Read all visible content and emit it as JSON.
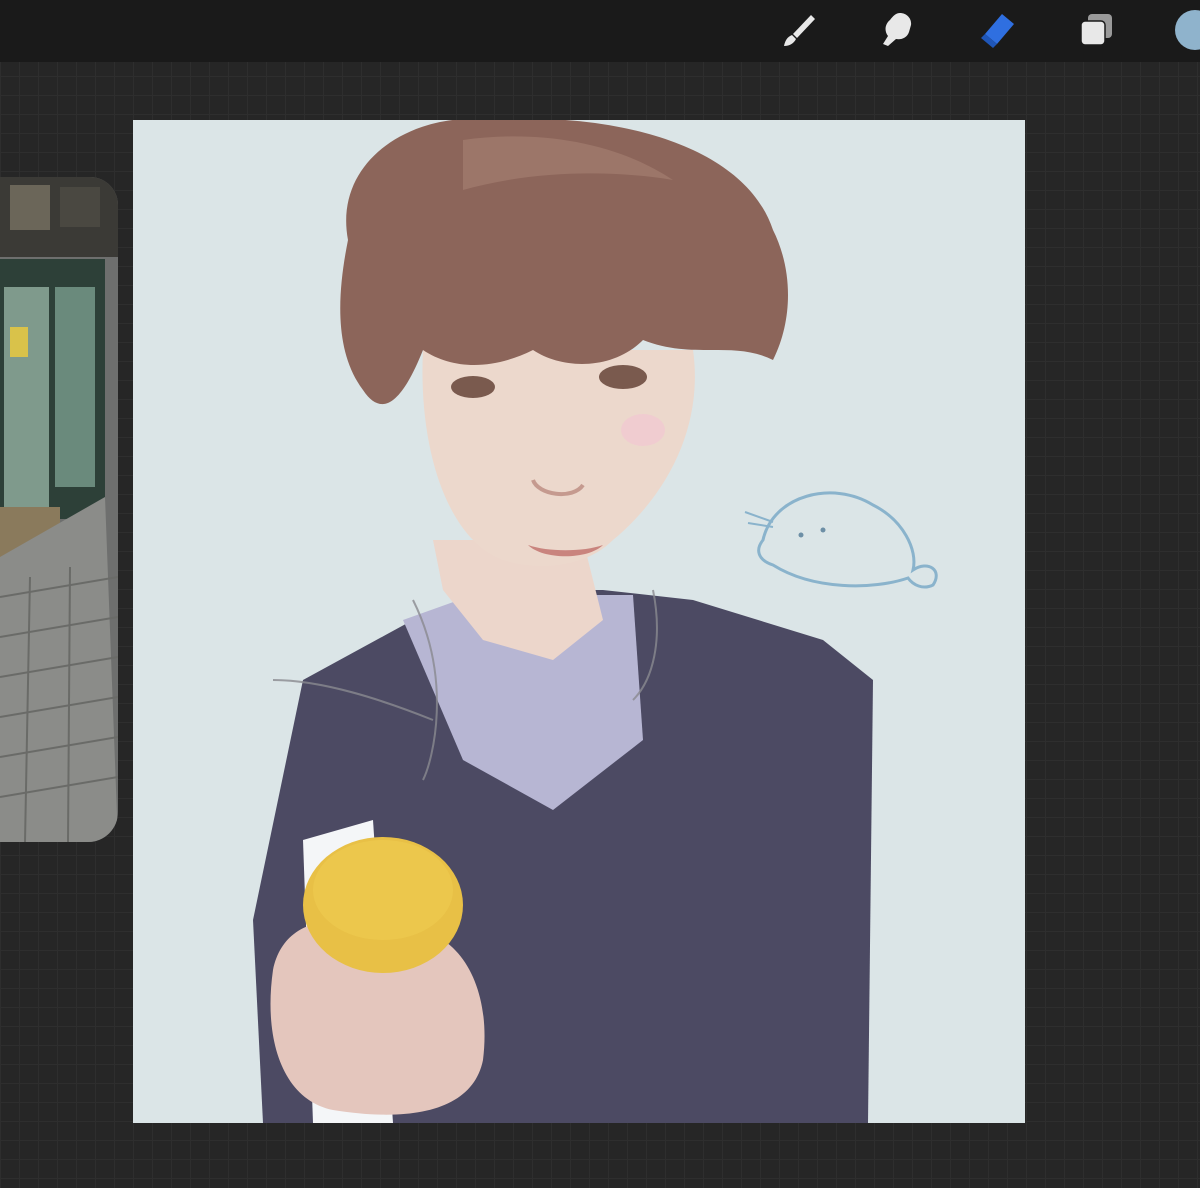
{
  "app": {
    "accent_color": "#2f6fe0",
    "toolbar_bg": "#1a1a1a",
    "canvas_bg": "#262626"
  },
  "toolbar": {
    "tools": [
      {
        "icon": "paintbrush-icon",
        "active": false
      },
      {
        "icon": "smudge-icon",
        "active": false
      },
      {
        "icon": "eraser-icon",
        "active": true
      },
      {
        "icon": "layers-icon",
        "active": false
      }
    ],
    "current_color": "#8fb3cc"
  },
  "reference_window": {
    "content": "street-storefront-photo"
  },
  "artwork": {
    "background_color": "#dbe5e7"
  }
}
